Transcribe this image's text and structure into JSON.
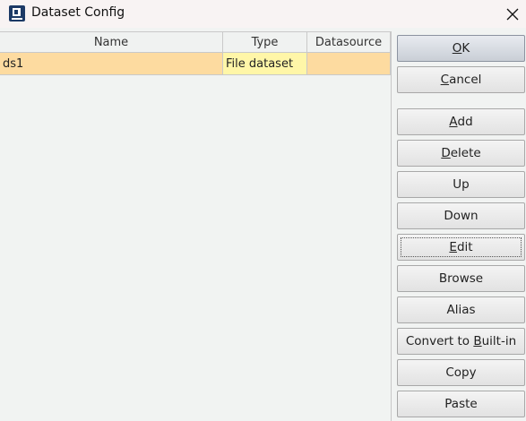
{
  "window": {
    "title": "Dataset Config",
    "icon": "app-logo-icon",
    "close_icon": "close-icon"
  },
  "table": {
    "columns": [
      "Name",
      "Type",
      "Datasource"
    ],
    "rows": [
      {
        "name": "ds1",
        "type": "File dataset",
        "datasource": ""
      }
    ],
    "selected_row": 0,
    "row_colors": {
      "name": "#fddba0",
      "type": "#fff6a8",
      "datasource": "#fddba0"
    }
  },
  "buttons": {
    "ok": {
      "pre": "",
      "mnemonic": "O",
      "post": "K"
    },
    "cancel": {
      "pre": "",
      "mnemonic": "C",
      "post": "ancel"
    },
    "add": {
      "pre": "",
      "mnemonic": "A",
      "post": "dd"
    },
    "delete": {
      "pre": "",
      "mnemonic": "D",
      "post": "elete"
    },
    "up": {
      "pre": "Up",
      "mnemonic": "",
      "post": ""
    },
    "down": {
      "pre": "Down",
      "mnemonic": "",
      "post": ""
    },
    "edit": {
      "pre": "",
      "mnemonic": "E",
      "post": "dit"
    },
    "browse": {
      "pre": "Browse",
      "mnemonic": "",
      "post": ""
    },
    "alias": {
      "pre": "Alias",
      "mnemonic": "",
      "post": ""
    },
    "convert": {
      "pre": "Convert to ",
      "mnemonic": "B",
      "post": "uilt-in"
    },
    "copy": {
      "pre": "Copy",
      "mnemonic": "",
      "post": ""
    },
    "paste": {
      "pre": "Paste",
      "mnemonic": "",
      "post": ""
    }
  },
  "focused_button": "edit"
}
